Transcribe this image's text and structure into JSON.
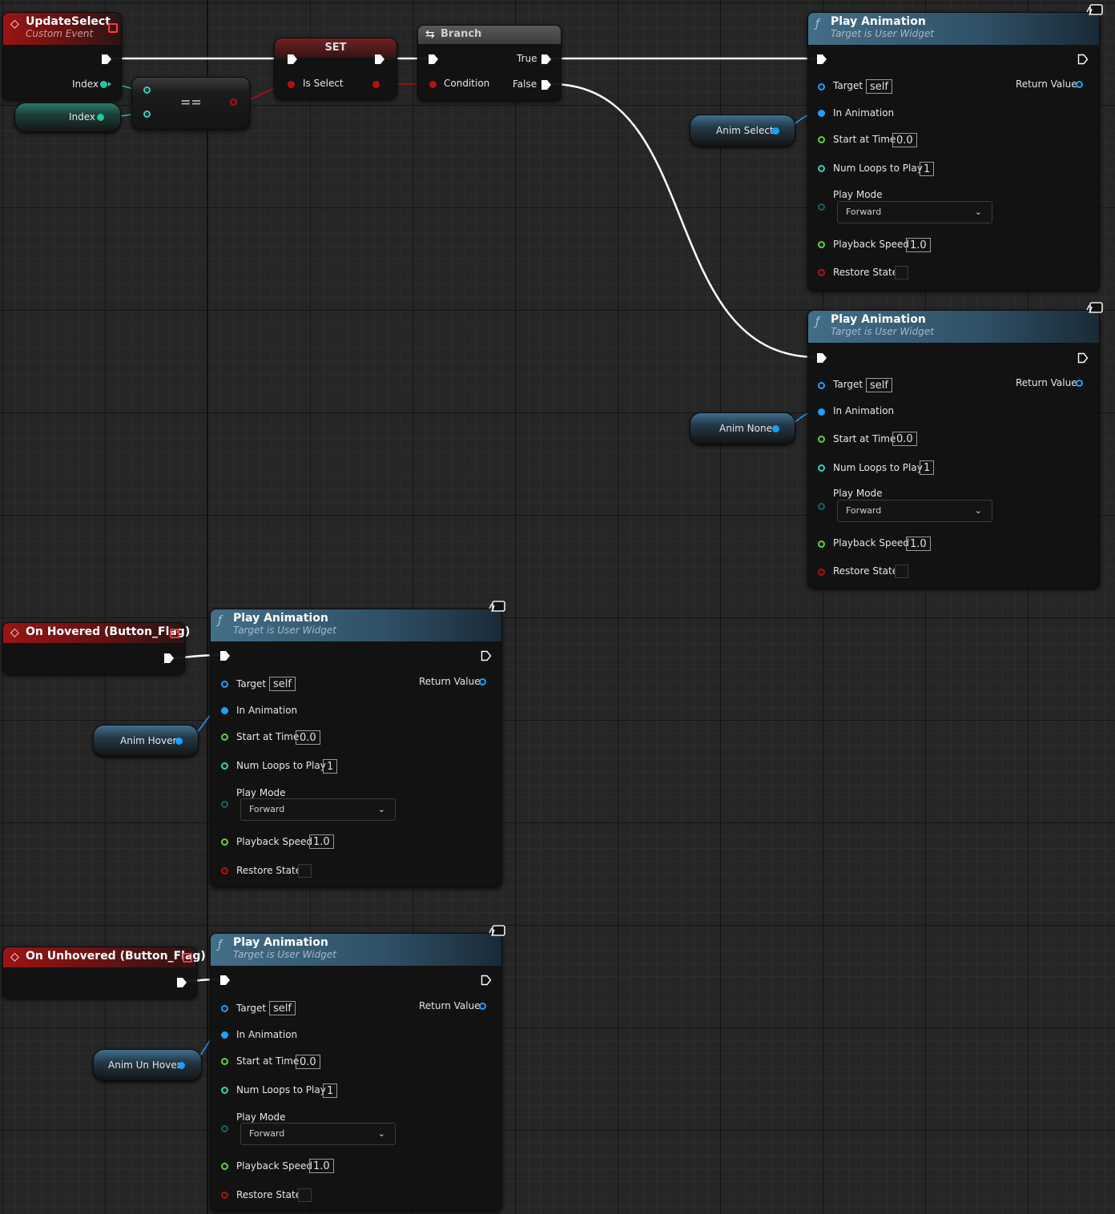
{
  "nodes": {
    "update_select": {
      "title": "UpdateSelect",
      "subtitle": "Custom Event",
      "index_label": "Index"
    },
    "index_var": {
      "label": "Index"
    },
    "equal": {
      "op": "=="
    },
    "set": {
      "title": "SET",
      "var_label": "Is Select"
    },
    "branch": {
      "title": "Branch",
      "condition": "Condition",
      "true_label": "True",
      "false_label": "False"
    },
    "on_hovered": {
      "title": "On Hovered (Button_Flag)"
    },
    "on_unhovered": {
      "title": "On Unhovered (Button_Flag)"
    },
    "anim_vars": {
      "select": "Anim Select",
      "none": "Anim None",
      "hover": "Anim Hover",
      "unhover": "Anim Un Hover"
    }
  },
  "play_animation": {
    "title": "Play Animation",
    "subtitle": "Target is User Widget",
    "target_label": "Target",
    "target_value": "self",
    "return_label": "Return Value",
    "in_animation": "In Animation",
    "start_label": "Start at Time",
    "start_value": "0.0",
    "loops_label": "Num Loops to Play",
    "loops_value": "1",
    "mode_label": "Play Mode",
    "mode_value": "Forward",
    "speed_label": "Playback Speed",
    "speed_value": "1.0",
    "restore_label": "Restore State"
  },
  "colors": {
    "exec_wire": "#ffffff",
    "object_pin": "#1aa0ff",
    "int_pin": "#1ec8a0",
    "bool_pin": "#b80f0f",
    "float_pin": "#66d03a",
    "event_header": "#9a1515",
    "function_header": "#436e88"
  },
  "icons": {
    "function": "function-icon",
    "event": "event-diamond-icon",
    "branch": "branch-icon",
    "widget": "widget-monitor-icon",
    "close": "close-icon"
  }
}
